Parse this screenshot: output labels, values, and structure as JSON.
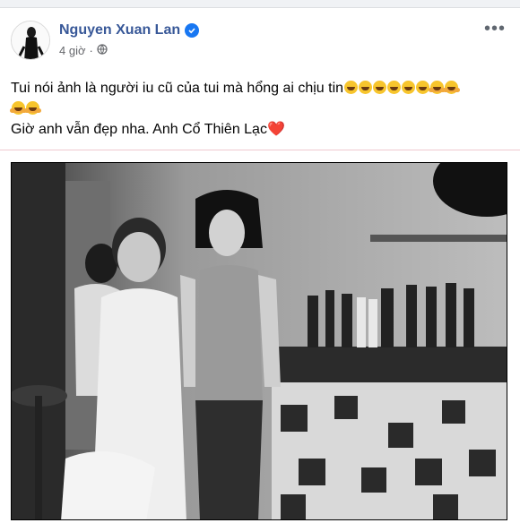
{
  "post": {
    "author": "Nguyen Xuan Lan",
    "time": "4 giờ",
    "privacy_icon": "globe-icon",
    "more_label": "•••",
    "line1": "Tui nói ảnh là người iu cũ của tui mà hổng ai chịu tin",
    "line2": "Giờ anh vẫn đẹp nha. Anh Cổ Thiên Lạc",
    "heart": "❤️"
  },
  "colors": {
    "author": "#385898",
    "verified": "#1877f2",
    "meta": "#65676b",
    "heart": "#e0245e"
  }
}
